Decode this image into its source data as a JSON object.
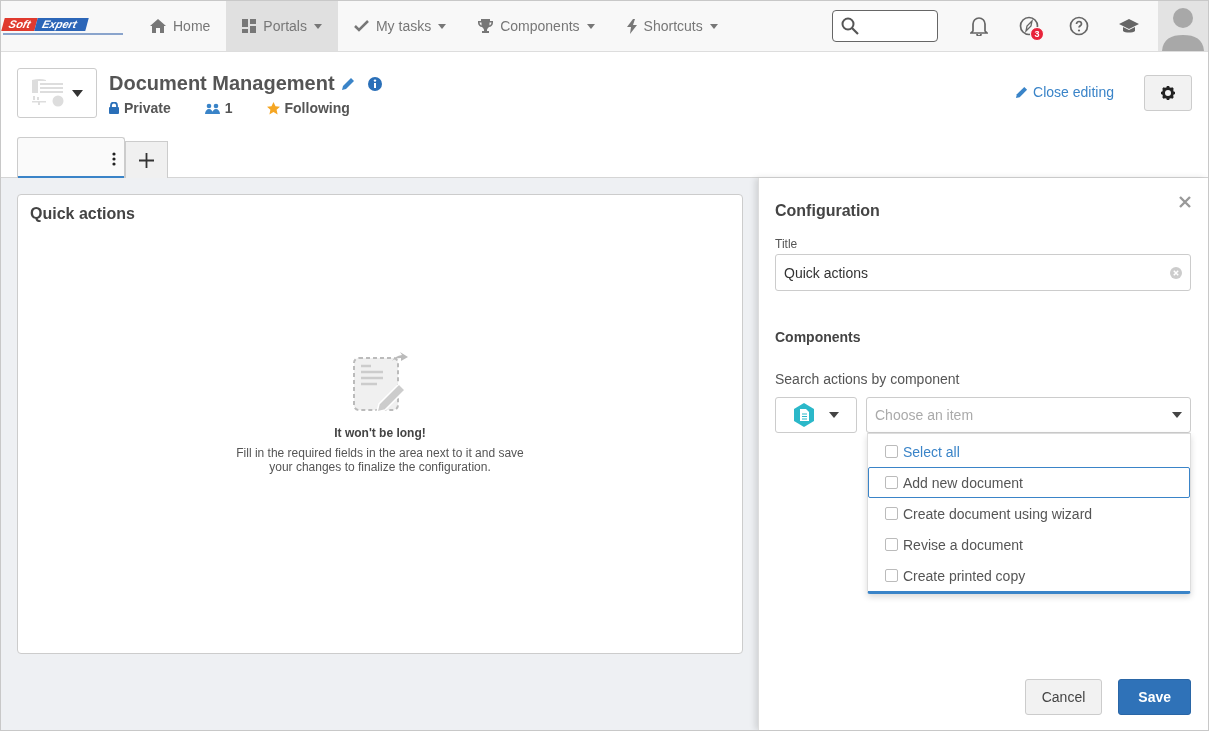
{
  "nav": {
    "logo": {
      "part_1": "Soft",
      "part_2": "Expert"
    },
    "items": [
      {
        "label": "Home",
        "has_menu": false,
        "selected": false
      },
      {
        "label": "Portals",
        "has_menu": true,
        "selected": true
      },
      {
        "label": "My tasks",
        "has_menu": true,
        "selected": false
      },
      {
        "label": "Components",
        "has_menu": true,
        "selected": false
      },
      {
        "label": "Shortcuts",
        "has_menu": true,
        "selected": false
      }
    ],
    "badge": "3"
  },
  "portal": {
    "title": "Document Management",
    "privacy": "Private",
    "members": "1",
    "follow": "Following",
    "close_editing": "Close editing"
  },
  "page_tabs": [
    {
      "selected": true
    }
  ],
  "widget": {
    "title": "Quick actions",
    "empty_title": "It won't be long!",
    "empty_text": "Fill in the required fields in the area next to it and save your changes to finalize the configuration."
  },
  "config": {
    "heading": "Configuration",
    "title_label": "Title",
    "title_value": "Quick actions",
    "components_heading": "Components",
    "search_label": "Search actions by component",
    "placeholder": "Choose an item",
    "dropdown_open": true,
    "options": [
      {
        "label": "Select all",
        "kind": "select_all",
        "checked": false,
        "focused": false
      },
      {
        "label": "Add new document",
        "kind": "item",
        "checked": false,
        "focused": true
      },
      {
        "label": "Create document using wizard",
        "kind": "item",
        "checked": false,
        "focused": false
      },
      {
        "label": "Revise a document",
        "kind": "item",
        "checked": false,
        "focused": false
      },
      {
        "label": "Create printed copy",
        "kind": "item",
        "checked": false,
        "focused": false
      }
    ],
    "buttons": [
      {
        "label": "Cancel",
        "kind": "secondary"
      },
      {
        "label": "Save",
        "kind": "primary"
      }
    ]
  }
}
